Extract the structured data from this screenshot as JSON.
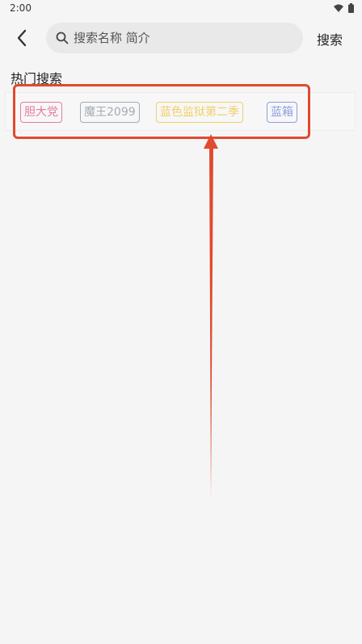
{
  "status": {
    "time": "2:00"
  },
  "search": {
    "placeholder": "搜索名称 简介",
    "button_label": "搜索"
  },
  "hot": {
    "title": "热门搜索",
    "tags": [
      {
        "label": "胆大党",
        "color": "#e67aa2"
      },
      {
        "label": "魔王2099",
        "color": "#a3abb3"
      },
      {
        "label": "蓝色监狱第二季",
        "color": "#f1cf67"
      },
      {
        "label": "蓝箱",
        "color": "#8e9ee3"
      }
    ]
  },
  "annotation": {
    "color": "#e04a2f"
  }
}
